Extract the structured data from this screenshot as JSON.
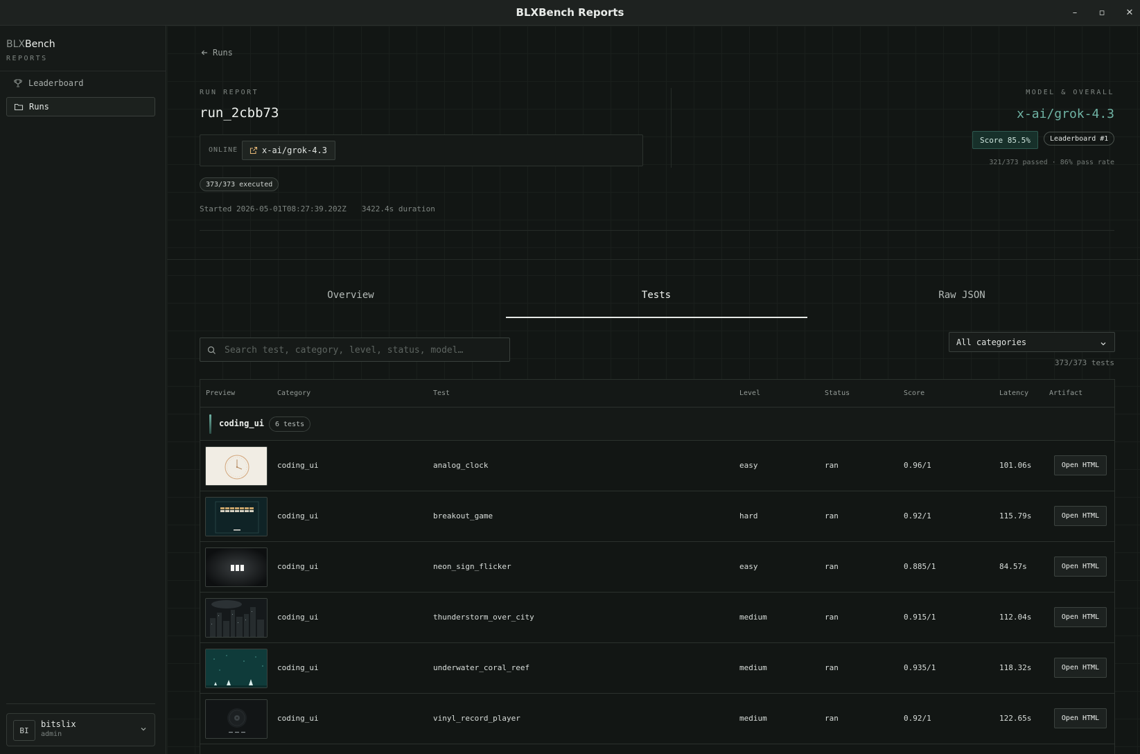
{
  "window": {
    "title": "BLXBench Reports",
    "minimize": "–",
    "restore": "▫",
    "close": "✕"
  },
  "sidebar": {
    "brand_a": "BLX",
    "brand_b": "Bench",
    "brand_sub": "REPORTS",
    "items": [
      {
        "label": "Leaderboard",
        "icon": "trophy-icon",
        "active": false
      },
      {
        "label": "Runs",
        "icon": "folder-icon",
        "active": true
      }
    ],
    "user": {
      "initials": "BI",
      "name": "bitslix",
      "role": "admin"
    }
  },
  "header": {
    "back_label": "Runs",
    "run_report_label": "RUN REPORT",
    "run_id": "run_2cbb73",
    "mode": "ONLINE",
    "model_chip": "x-ai/grok-4.3",
    "executed": "373/373 executed",
    "started": "Started 2026-05-01T08:27:39.202Z",
    "duration": "3422.4s duration",
    "model_overall_label": "MODEL & OVERALL",
    "model_name": "x-ai/grok-4.3",
    "score_badge": "Score 85.5%",
    "leaderboard_badge": "Leaderboard #1",
    "pass_line": "321/373 passed · 86% pass rate"
  },
  "tabs": [
    {
      "label": "Overview",
      "active": false
    },
    {
      "label": "Tests",
      "active": true
    },
    {
      "label": "Raw JSON",
      "active": false
    }
  ],
  "filters": {
    "search_placeholder": "Search test, category, level, status, model…",
    "category_select": "All categories",
    "count": "373/373 tests"
  },
  "table": {
    "columns": [
      "Preview",
      "Category",
      "Test",
      "Level",
      "Status",
      "Score",
      "Latency",
      "Artifact"
    ],
    "group": {
      "name": "coding_ui",
      "count": "6 tests"
    },
    "rows": [
      {
        "category": "coding_ui",
        "test": "analog_clock",
        "level": "easy",
        "status": "ran",
        "score": "0.96/1",
        "latency": "101.06s",
        "artifact": "Open HTML",
        "preview": "clock"
      },
      {
        "category": "coding_ui",
        "test": "breakout_game",
        "level": "hard",
        "status": "ran",
        "score": "0.92/1",
        "latency": "115.79s",
        "artifact": "Open HTML",
        "preview": "breakout"
      },
      {
        "category": "coding_ui",
        "test": "neon_sign_flicker",
        "level": "easy",
        "status": "ran",
        "score": "0.885/1",
        "latency": "84.57s",
        "artifact": "Open HTML",
        "preview": "neon"
      },
      {
        "category": "coding_ui",
        "test": "thunderstorm_over_city",
        "level": "medium",
        "status": "ran",
        "score": "0.915/1",
        "latency": "112.04s",
        "artifact": "Open HTML",
        "preview": "city"
      },
      {
        "category": "coding_ui",
        "test": "underwater_coral_reef",
        "level": "medium",
        "status": "ran",
        "score": "0.935/1",
        "latency": "118.32s",
        "artifact": "Open HTML",
        "preview": "reef"
      },
      {
        "category": "coding_ui",
        "test": "vinyl_record_player",
        "level": "medium",
        "status": "ran",
        "score": "0.92/1",
        "latency": "122.65s",
        "artifact": "Open HTML",
        "preview": "vinyl"
      }
    ]
  },
  "colors": {
    "accent": "#6fb3a4",
    "background": "#121614",
    "sidebar": "#161a18"
  }
}
